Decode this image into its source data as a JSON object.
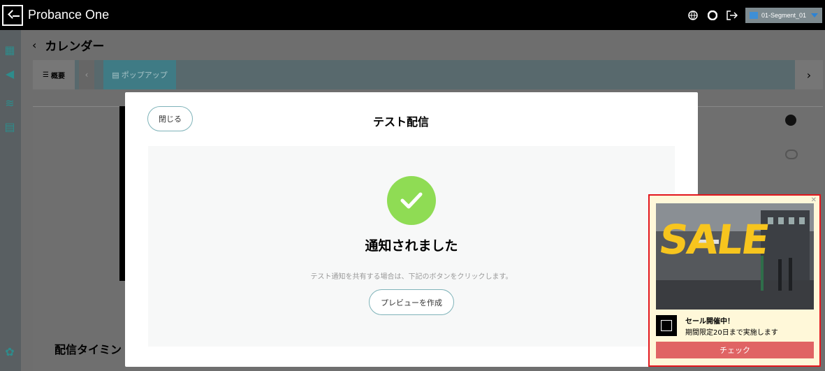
{
  "app": {
    "title": "Probance One"
  },
  "topbar": {
    "segment": "01-Segment_01"
  },
  "page": {
    "title": "カレンダー",
    "tabs": {
      "overview": "概要",
      "popup": "ポップアップ"
    },
    "timing_label": "配信タイミン"
  },
  "modal": {
    "close_label": "閉じる",
    "title": "テスト配信",
    "success_title": "通知されました",
    "description": "テスト通知を共有する場合は、下記のボタンをクリックします。",
    "preview_button": "プレビューを作成"
  },
  "popup": {
    "sale_text": "SALE",
    "title": "セール開催中！",
    "subtitle": "期間限定20日まで実施します",
    "check_button": "チェック"
  },
  "colors": {
    "accent": "#3f7b85",
    "success": "#8fdc54",
    "popup_border": "#e3161d",
    "popup_button": "#e06464"
  }
}
